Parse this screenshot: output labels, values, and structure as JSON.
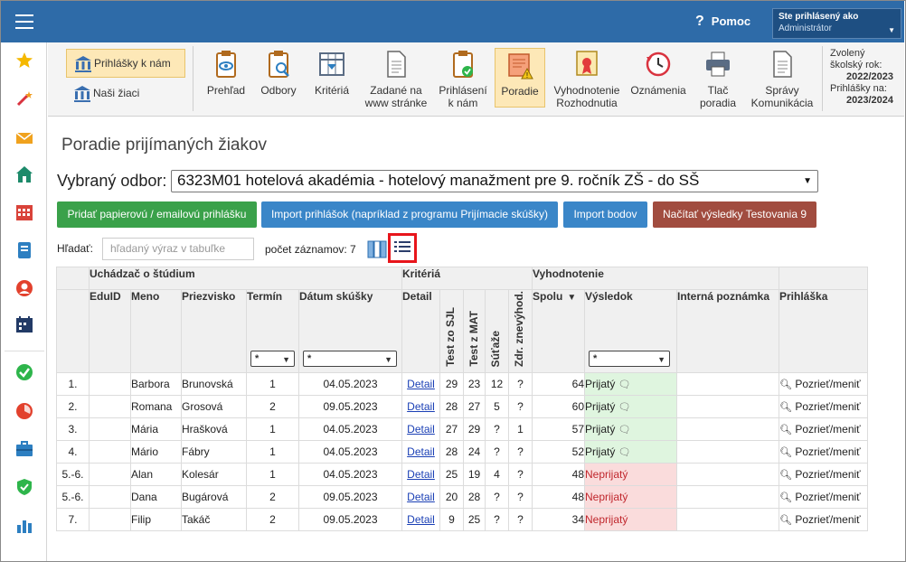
{
  "topbar": {
    "help_label": "Pomoc",
    "help_symbol": "?",
    "user_line1": "Ste prihlásený ako",
    "user_line2": "Administrátor"
  },
  "leftnav": {
    "icons": [
      "star-icon",
      "magic-wand-icon",
      "envelope-icon",
      "home-icon",
      "calendar-grid-icon",
      "address-book-icon",
      "user-icon",
      "schedule-icon",
      "check-badge-icon",
      "chart-pie-icon",
      "briefcase-icon",
      "shield-icon",
      "bar-chart-icon"
    ]
  },
  "ribbon": {
    "side": [
      "Prihlášky k nám",
      "Naši žiaci"
    ],
    "buttons": [
      {
        "l1": "Prehľad",
        "l2": ""
      },
      {
        "l1": "Odbory",
        "l2": ""
      },
      {
        "l1": "Kritériá",
        "l2": ""
      },
      {
        "l1": "Zadané na",
        "l2": "www stránke"
      },
      {
        "l1": "Prihlásení",
        "l2": "k nám"
      },
      {
        "l1": "Poradie",
        "l2": ""
      },
      {
        "l1": "Vyhodnotenie",
        "l2": "Rozhodnutia"
      },
      {
        "l1": "Oznámenia",
        "l2": ""
      },
      {
        "l1": "Tlač",
        "l2": "poradia"
      },
      {
        "l1": "Správy",
        "l2": "Komunikácia"
      }
    ],
    "year_label1": "Zvolený",
    "year_label2": "školský rok:",
    "year_value": "2022/2023",
    "apps_label": "Prihlášky na:",
    "apps_value": "2023/2024"
  },
  "page": {
    "title": "Poradie prijímaných žiakov",
    "odbor_label": "Vybraný odbor:",
    "odbor_value": "6323M01 hotelová akadémia - hotelový manažment pre 9. ročník ZŠ - do SŠ",
    "btn_add": "Pridať papierovú / emailovú prihlášku",
    "btn_import": "Import prihlášok (napríklad z programu Prijímacie skúšky)",
    "btn_points": "Import bodov",
    "btn_test": "Načítať výsledky Testovania 9",
    "search_label": "Hľadať:",
    "search_placeholder": "hľadaný výraz v tabuľke",
    "count_label": "počet záznamov: 7",
    "colors": {
      "green": "#3aa14a",
      "blue": "#3a86c8",
      "brown": "#a14c3f"
    }
  },
  "table": {
    "groups": [
      "Uchádzač o štúdium",
      "Kritériá",
      "Vyhodnotenie"
    ],
    "headers": {
      "eduid": "EduID",
      "meno": "Meno",
      "priezvisko": "Priezvisko",
      "termin": "Termín",
      "datum": "Dátum skúšky",
      "detail": "Detail",
      "sjl": "Test zo SJL",
      "mat": "Test z MAT",
      "sutaze": "Súťaže",
      "zdr": "Zdr. znevýhod.",
      "spolu": "Spolu",
      "vysledok": "Výsledok",
      "poznamka": "Interná poznámka",
      "prihlaska": "Prihláška"
    },
    "filter_value": "*",
    "rows": [
      {
        "rank": "1.",
        "eduid": "",
        "meno": "Barbora",
        "priezvisko": "Brunovská",
        "termin": "1",
        "datum": "04.05.2023",
        "detail": "Detail",
        "sjl": "29",
        "mat": "23",
        "sutaze": "12",
        "zdr": "?",
        "spolu": "64",
        "vysledok": "Prijatý",
        "status": "prij",
        "prihlaska": "Pozrieť/meniť"
      },
      {
        "rank": "2.",
        "eduid": "",
        "meno": "Romana",
        "priezvisko": "Grosová",
        "termin": "2",
        "datum": "09.05.2023",
        "detail": "Detail",
        "sjl": "28",
        "mat": "27",
        "sutaze": "5",
        "zdr": "?",
        "spolu": "60",
        "vysledok": "Prijatý",
        "status": "prij",
        "prihlaska": "Pozrieť/meniť"
      },
      {
        "rank": "3.",
        "eduid": "",
        "meno": "Mária",
        "priezvisko": "Hrašková",
        "termin": "1",
        "datum": "04.05.2023",
        "detail": "Detail",
        "sjl": "27",
        "mat": "29",
        "sutaze": "?",
        "zdr": "1",
        "spolu": "57",
        "vysledok": "Prijatý",
        "status": "prij",
        "prihlaska": "Pozrieť/meniť"
      },
      {
        "rank": "4.",
        "eduid": "",
        "meno": "Mário",
        "priezvisko": "Fábry",
        "termin": "1",
        "datum": "04.05.2023",
        "detail": "Detail",
        "sjl": "28",
        "mat": "24",
        "sutaze": "?",
        "zdr": "?",
        "spolu": "52",
        "vysledok": "Prijatý",
        "status": "prij",
        "prihlaska": "Pozrieť/meniť"
      },
      {
        "rank": "5.-6.",
        "eduid": "",
        "meno": "Alan",
        "priezvisko": "Kolesár",
        "termin": "1",
        "datum": "04.05.2023",
        "detail": "Detail",
        "sjl": "25",
        "mat": "19",
        "sutaze": "4",
        "zdr": "?",
        "spolu": "48",
        "vysledok": "Neprijatý",
        "status": "neprij",
        "prihlaska": "Pozrieť/meniť"
      },
      {
        "rank": "5.-6.",
        "eduid": "",
        "meno": "Dana",
        "priezvisko": "Bugárová",
        "termin": "2",
        "datum": "09.05.2023",
        "detail": "Detail",
        "sjl": "20",
        "mat": "28",
        "sutaze": "?",
        "zdr": "?",
        "spolu": "48",
        "vysledok": "Neprijatý",
        "status": "neprij",
        "prihlaska": "Pozrieť/meniť"
      },
      {
        "rank": "7.",
        "eduid": "",
        "meno": "Filip",
        "priezvisko": "Takáč",
        "termin": "2",
        "datum": "09.05.2023",
        "detail": "Detail",
        "sjl": "9",
        "mat": "25",
        "sutaze": "?",
        "zdr": "?",
        "spolu": "34",
        "vysledok": "Neprijatý",
        "status": "neprij",
        "prihlaska": "Pozrieť/meniť"
      }
    ]
  }
}
